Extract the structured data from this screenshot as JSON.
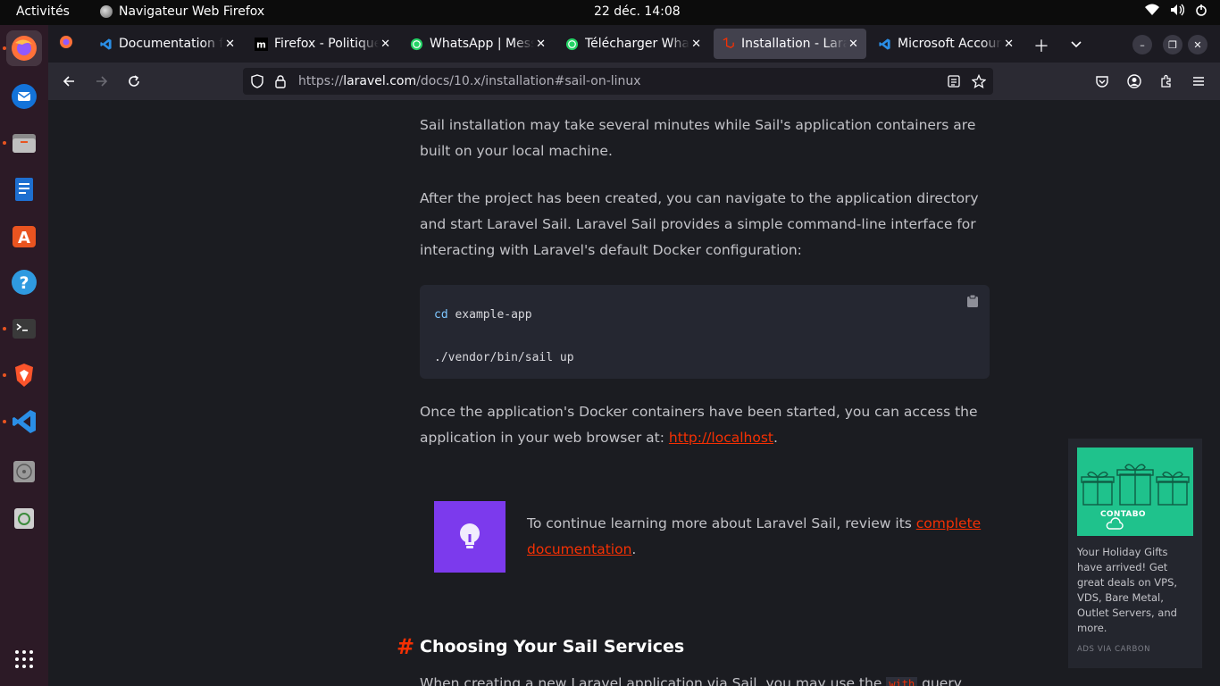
{
  "system_bar": {
    "activities": "Activités",
    "app_name": "Navigateur Web Firefox",
    "clock": "22 déc.  14:08"
  },
  "dock": {
    "items": [
      "firefox-icon",
      "thunderbird-icon",
      "files-icon",
      "writer-icon",
      "app-center-icon",
      "help-icon",
      "terminal-icon",
      "brave-icon",
      "vscode-icon",
      "disc-icon",
      "trash-icon",
      "app-grid-icon"
    ]
  },
  "tabs": [
    {
      "title": "Documentation for Visual Studio Code",
      "icon": "vscode-icon"
    },
    {
      "title": "Firefox - Politique de confidentialité",
      "icon": "mozilla-icon"
    },
    {
      "title": "WhatsApp | Messagerie",
      "icon": "whatsapp-icon"
    },
    {
      "title": "Télécharger WhatsApp",
      "icon": "whatsapp-icon"
    },
    {
      "title": "Installation - Laravel",
      "icon": "laravel-icon",
      "selected": true
    },
    {
      "title": "Microsoft Account",
      "icon": "vscode-icon"
    }
  ],
  "navbar": {
    "url_scheme": "https://",
    "url_host": "laravel.com",
    "url_path": "/docs/10.x/installation#sail-on-linux"
  },
  "content": {
    "para1": "Sail installation may take several minutes while Sail's application containers are built on your local machine.",
    "para2": "After the project has been created, you can navigate to the application directory and start Laravel Sail. Laravel Sail provides a simple command-line interface for interacting with Laravel's default Docker configuration:",
    "code_line1_kw": "cd",
    "code_line1_rest": " example-app",
    "code_line2": "./vendor/bin/sail up",
    "para3_before": "Once the application's Docker containers have been started, you can access the application in your web browser at: ",
    "para3_link": "http://localhost",
    "para3_after": ".",
    "callout_before": "To continue learning more about Laravel Sail, review its ",
    "callout_link": "complete documentation",
    "callout_after": ".",
    "section_hash": "#",
    "section_title": "Choosing Your Sail Services",
    "cut_before": "When creating a new Laravel application via Sail, you may use the ",
    "cut_code": "with",
    "cut_after": " query"
  },
  "ad": {
    "brand": "CONTABO",
    "text": "Your Holiday Gifts have arrived! Get great deals on VPS, VDS, Bare Metal, Outlet Servers, and more.",
    "via": "ADS VIA CARBON"
  },
  "colors": {
    "accent": "#f53003",
    "callout": "#7c3aed",
    "ad_green": "#1fc28c"
  }
}
